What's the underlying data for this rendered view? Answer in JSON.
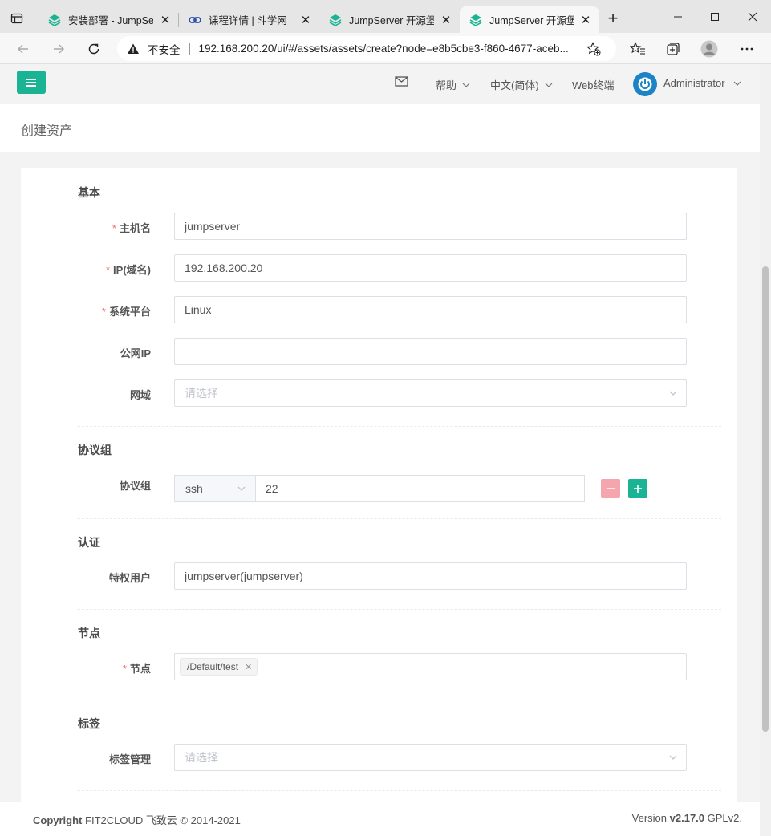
{
  "browser": {
    "tabs": [
      {
        "title": "安装部署 - JumpServer",
        "icon": "jumpserver-icon"
      },
      {
        "title": "课程详情 | 斗学网",
        "icon": "link-icon"
      },
      {
        "title": "JumpServer 开源堡垒机",
        "icon": "jumpserver-icon"
      },
      {
        "title": "JumpServer 开源堡垒机",
        "icon": "jumpserver-icon",
        "active": true
      }
    ],
    "insecure_label": "不安全",
    "url": "192.168.200.20/ui/#/assets/assets/create?node=e8b5cbe3-f860-4677-aceb..."
  },
  "topnav": {
    "help": "帮助",
    "language": "中文(简体)",
    "web_terminal": "Web终端",
    "user": "Administrator"
  },
  "page": {
    "title": "创建资产"
  },
  "form": {
    "basic": {
      "title": "基本",
      "hostname_label": "主机名",
      "hostname_value": "jumpserver",
      "ip_label": "IP(域名)",
      "ip_value": "192.168.200.20",
      "platform_label": "系统平台",
      "platform_value": "Linux",
      "public_ip_label": "公网IP",
      "public_ip_value": "",
      "domain_label": "网域",
      "domain_placeholder": "请选择"
    },
    "protocols": {
      "title": "协议组",
      "label": "协议组",
      "protocol": "ssh",
      "port": "22"
    },
    "auth": {
      "title": "认证",
      "admin_user_label": "特权用户",
      "admin_user_value": "jumpserver(jumpserver)"
    },
    "nodes": {
      "title": "节点",
      "label": "节点",
      "tags": [
        "/Default/test"
      ]
    },
    "labels": {
      "title": "标签",
      "label": "标签管理",
      "placeholder": "请选择"
    }
  },
  "footer": {
    "copyright_bold": "Copyright",
    "copyright_rest": "FIT2CLOUD 飞致云 © 2014-2021",
    "version_prefix": "Version",
    "version": "v2.17.0",
    "license": "GPLv2."
  },
  "colors": {
    "primary": "#1ab394",
    "danger_light": "#f5a5ad",
    "required": "#f56c6c",
    "avatar": "#1c84c6"
  }
}
